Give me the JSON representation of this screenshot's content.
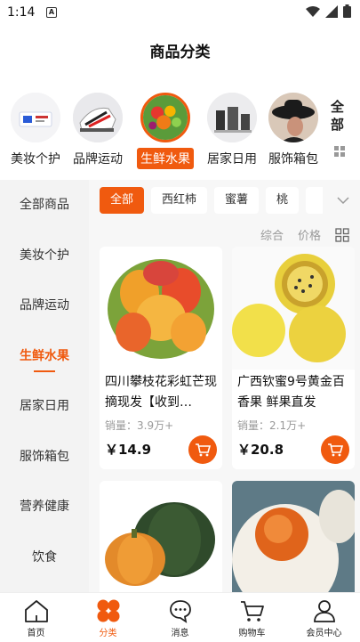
{
  "status_bar": {
    "time": "1:14",
    "notification_icon": "A"
  },
  "header": {
    "title": "商品分类"
  },
  "categories": [
    {
      "label": "美妆个护",
      "active": false
    },
    {
      "label": "品牌运动",
      "active": false
    },
    {
      "label": "生鲜水果",
      "active": true
    },
    {
      "label": "居家日用",
      "active": false
    },
    {
      "label": "服饰箱包",
      "active": false
    }
  ],
  "category_all": "全部",
  "sidebar": {
    "items": [
      {
        "label": "全部商品"
      },
      {
        "label": "美妆个护"
      },
      {
        "label": "品牌运动"
      },
      {
        "label": "生鲜水果",
        "active": true
      },
      {
        "label": "居家日用"
      },
      {
        "label": "服饰箱包"
      },
      {
        "label": "营养健康"
      },
      {
        "label": "饮食"
      }
    ]
  },
  "filter_chips": [
    {
      "label": "全部",
      "active": true
    },
    {
      "label": "西红柿"
    },
    {
      "label": "蜜薯"
    },
    {
      "label": "桃"
    }
  ],
  "sort": {
    "comprehensive": "综合",
    "price": "价格"
  },
  "products": [
    {
      "title": "四川攀枝花彩虹芒现摘现发【收到…",
      "sales": "销量：3.9万+",
      "price": "￥14.9"
    },
    {
      "title": "广西钦蜜9号黄金百香果 鲜果直发",
      "sales": "销量：2.1万+",
      "price": "￥20.8"
    },
    {
      "title": "",
      "sales": "",
      "price": ""
    },
    {
      "title": "",
      "sales": "",
      "price": ""
    }
  ],
  "tabbar": [
    {
      "label": "首页"
    },
    {
      "label": "分类",
      "active": true
    },
    {
      "label": "消息"
    },
    {
      "label": "购物车"
    },
    {
      "label": "会员中心"
    }
  ],
  "colors": {
    "accent": "#f05a0f"
  }
}
